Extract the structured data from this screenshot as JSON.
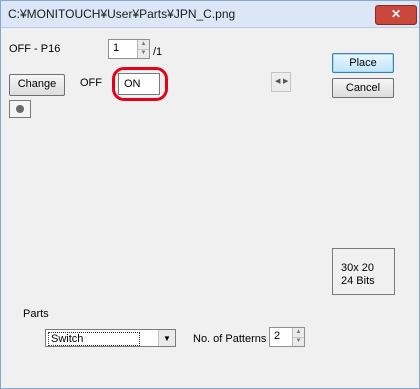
{
  "window": {
    "title": "C:¥MONITOUCH¥User¥Parts¥JPN_C.png",
    "close_label": "✕"
  },
  "pattern": {
    "label": "OFF - P16",
    "value": "1",
    "total": "/1"
  },
  "states": {
    "change_label": "Change",
    "off_label": "OFF",
    "on_value": "ON"
  },
  "buttons": {
    "place_label": "Place",
    "cancel_label": "Cancel"
  },
  "info": {
    "size": "30x  20",
    "bits": "24 Bits"
  },
  "parts": {
    "label": "Parts",
    "selected": "Switch",
    "patterns_label": "No. of Patterns",
    "patterns_value": "2"
  },
  "icons": {
    "spin": "spin-arrows-icon",
    "nav": "left-right-arrows-icon",
    "dot": "indicator-dot-icon"
  },
  "colors": {
    "highlight": "#e0001b",
    "title_bg": "#dbe7f6",
    "close_bg": "#c8463a"
  }
}
